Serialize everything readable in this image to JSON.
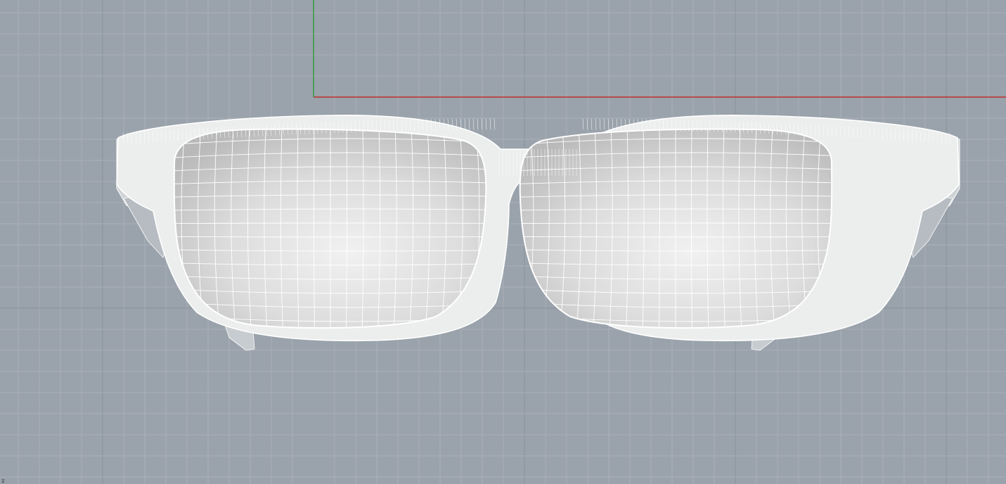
{
  "viewport": {
    "background_color": "#9aa2ab",
    "grid_minor_color": "#a9b0b8",
    "grid_major_color": "#8c949d",
    "x_axis_color": "#c0302e",
    "y_axis_color": "#2e9a3c",
    "wireframe_color": "#ffffff",
    "corner_axis_label": "z"
  },
  "model": {
    "icon": "eyeglasses-wireframe-icon"
  }
}
